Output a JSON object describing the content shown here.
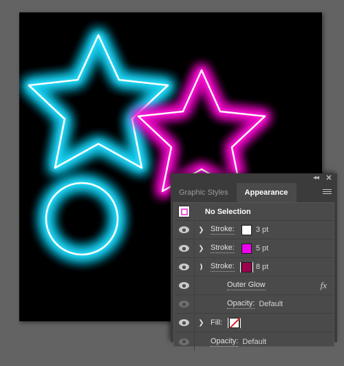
{
  "window": {
    "background_color": "#636363",
    "canvas_color": "#000000"
  },
  "artwork": {
    "description": "Neon glow artwork on black artboard",
    "shapes": [
      {
        "name": "star-cyan",
        "type": "star",
        "core_color": "#ffffff",
        "glow_color": "#18d8f5"
      },
      {
        "name": "star-magenta",
        "type": "star",
        "core_color": "#ffffff",
        "glow_color": "#ff1ecb"
      },
      {
        "name": "circle-cyan",
        "type": "circle",
        "core_color": "#ffffff",
        "glow_color": "#18d8f5"
      }
    ]
  },
  "panel": {
    "titlebar": {
      "collapse_icon": "◂◂",
      "close_icon": "✕"
    },
    "tabs": [
      {
        "label": "Graphic Styles",
        "active": false
      },
      {
        "label": "Appearance",
        "active": true
      }
    ],
    "menu_icon": "hamburger-menu-icon",
    "rows": [
      {
        "id": "no-selection",
        "kind": "header",
        "label": "No Selection",
        "icon": "no-selection-icon",
        "icon_border_color": "#e659d6"
      },
      {
        "id": "stroke-3pt",
        "kind": "item",
        "eye": "visible",
        "disclosure": "collapsed",
        "label": "Stroke:",
        "swatch_color": "#ffffff",
        "swatch_selected": false,
        "value": "3 pt",
        "indent": 0
      },
      {
        "id": "stroke-5pt",
        "kind": "item",
        "eye": "visible",
        "disclosure": "collapsed",
        "label": "Stroke:",
        "swatch_color": "#ee00ee",
        "swatch_selected": false,
        "value": "5 pt",
        "indent": 0
      },
      {
        "id": "stroke-8pt",
        "kind": "item",
        "eye": "visible",
        "disclosure": "expanded",
        "label": "Stroke:",
        "swatch_color": "#9e0050",
        "swatch_selected": true,
        "value": "8 pt",
        "indent": 0
      },
      {
        "id": "outer-glow",
        "kind": "effect",
        "eye": "visible",
        "disclosure": "none",
        "label": "Outer Glow",
        "fx_icon": "fx",
        "indent": 1
      },
      {
        "id": "stroke-opacity",
        "kind": "opacity",
        "eye": "dimmed",
        "disclosure": "none",
        "label": "Opacity:",
        "value": "Default",
        "indent": 1
      },
      {
        "id": "fill",
        "kind": "item",
        "eye": "visible",
        "disclosure": "collapsed",
        "label": "Fill:",
        "swatch_color": "none",
        "swatch_selected": false,
        "value": "",
        "indent": 0
      },
      {
        "id": "object-opacity",
        "kind": "opacity",
        "eye": "dimmed",
        "disclosure": "none",
        "label": "Opacity:",
        "value": "Default",
        "indent": 0
      }
    ]
  }
}
